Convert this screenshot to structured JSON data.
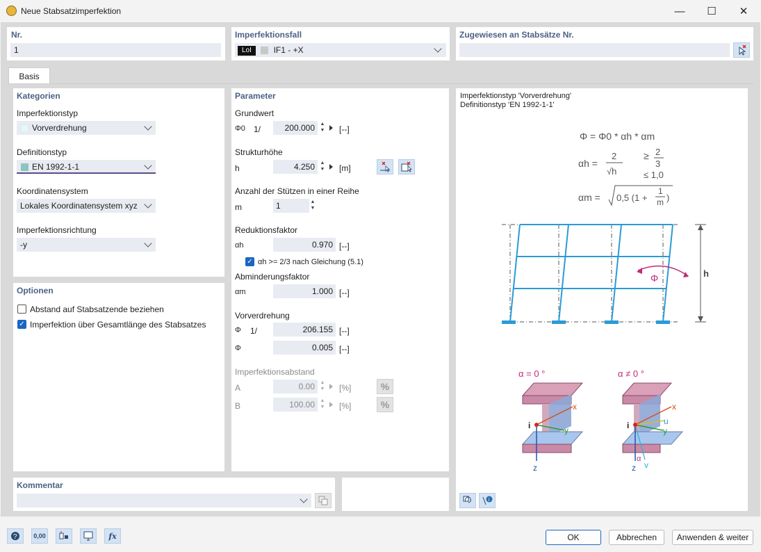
{
  "window": {
    "title": "Neue Stabsatzimperfektion"
  },
  "nr": {
    "header": "Nr.",
    "value": "1"
  },
  "imperfektionsfall": {
    "header": "Imperfektionsfall",
    "badge": "LoI",
    "value": "IF1 - +X"
  },
  "zugewiesen": {
    "header": "Zugewiesen an Stabsätze Nr.",
    "value": ""
  },
  "tabs": [
    {
      "label": "Basis"
    }
  ],
  "kategorien": {
    "header": "Kategorien",
    "imperfektionstyp": {
      "label": "Imperfektionstyp",
      "value": "Vorverdrehung",
      "color": "#e6f7fb"
    },
    "definitionstyp": {
      "label": "Definitionstyp",
      "value": "EN 1992-1-1",
      "color": "#8cc4c4"
    },
    "koordinatensystem": {
      "label": "Koordinatensystem",
      "value": "Lokales Koordinatensystem xyz"
    },
    "imperfektionsrichtung": {
      "label": "Imperfektionsrichtung",
      "value": "-y"
    }
  },
  "optionen": {
    "header": "Optionen",
    "items": [
      {
        "label": "Abstand auf Stabsatzende beziehen",
        "checked": false
      },
      {
        "label": "Imperfektion über Gesamtlänge des Stabsatzes",
        "checked": true
      }
    ]
  },
  "parameter": {
    "header": "Parameter",
    "grundwert": {
      "label": "Grundwert",
      "sym": "Φ0",
      "prefix": "1/",
      "value": "200.000",
      "unit": "[--]"
    },
    "strukturhoehe": {
      "label": "Strukturhöhe",
      "sym": "h",
      "value": "4.250",
      "unit": "[m]"
    },
    "stuetzen": {
      "label": "Anzahl der Stützen in einer Reihe",
      "sym": "m",
      "value": "1"
    },
    "reduktion": {
      "label": "Reduktionsfaktor",
      "sym": "αh",
      "value": "0.970",
      "unit": "[--]",
      "check_label": "αh >= 2/3 nach Gleichung (5.1)"
    },
    "abminderung": {
      "label": "Abminderungsfaktor",
      "sym": "αm",
      "value": "1.000",
      "unit": "[--]"
    },
    "vorverdrehung": {
      "label": "Vorverdrehung",
      "sym1": "Φ",
      "prefix": "1/",
      "value1": "206.155",
      "unit1": "[--]",
      "sym2": "Φ",
      "value2": "0.005",
      "unit2": "[--]"
    },
    "abstand": {
      "label": "Imperfektionsabstand",
      "a_sym": "A",
      "a_value": "0.00",
      "a_unit": "[%]",
      "b_sym": "B",
      "b_value": "100.00",
      "b_unit": "[%]"
    }
  },
  "info": {
    "line1": "Imperfektionstyp 'Vorverdrehung'",
    "line2": "Definitionstyp 'EN 1992-1-1'",
    "formula_phi": "Φ = Φ0 * αh * αm",
    "formula_ah_lhs": "αh =",
    "formula_ah_num": "2",
    "formula_ah_den": "√h",
    "formula_ah_ge": "≥",
    "formula_ah_frac_num": "2",
    "formula_ah_frac_den": "3",
    "formula_ah_le": "≤ 1,0",
    "formula_am_lhs": "αm =",
    "formula_am_rhs": "0,5 (1 +",
    "formula_am_num": "1",
    "formula_am_den": "m",
    "formula_am_close": ")",
    "frame_phi": "Φ",
    "frame_h": "h",
    "alpha0": "α = 0 °",
    "alphaN": "α ≠ 0 °",
    "axis_i": "i",
    "axis_x": "x",
    "axis_y": "y",
    "axis_z": "z",
    "axis_u": "u",
    "axis_v": "v",
    "axis_a": "α"
  },
  "kommentar": {
    "header": "Kommentar",
    "value": ""
  },
  "buttons": {
    "ok": "OK",
    "cancel": "Abbrechen",
    "apply": "Anwenden & weiter"
  },
  "footer_icons": {
    "units": "0,00",
    "fx": "fx"
  }
}
